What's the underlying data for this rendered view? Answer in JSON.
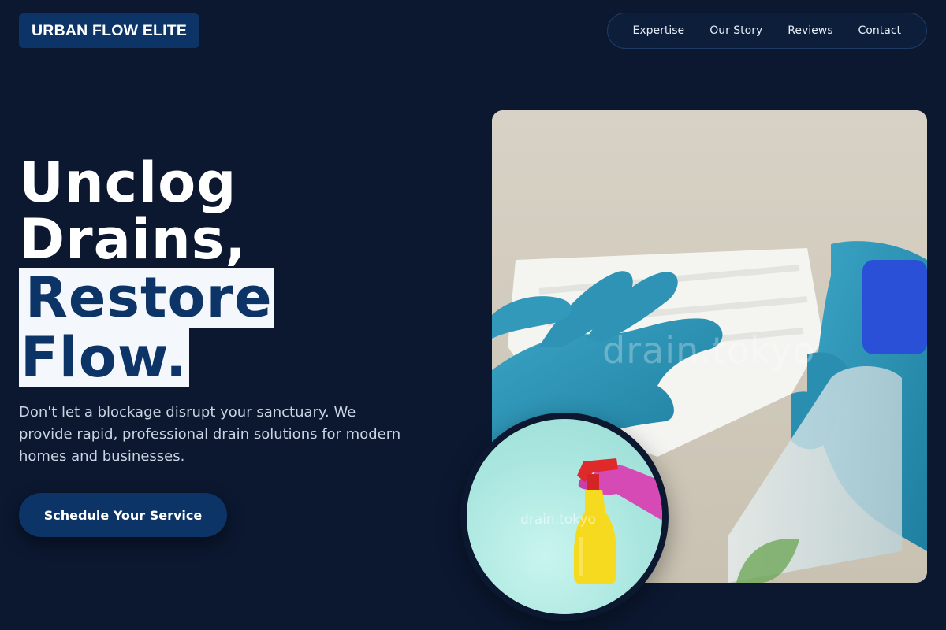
{
  "brand": {
    "name": "URBAN FLOW ELITE"
  },
  "nav": {
    "items": [
      {
        "label": "Expertise"
      },
      {
        "label": "Our Story"
      },
      {
        "label": "Reviews"
      },
      {
        "label": "Contact"
      }
    ]
  },
  "hero": {
    "headline_line1": "Unclog",
    "headline_line2": "Drains,",
    "headline_highlight1": "Restore",
    "headline_highlight2": "Flow.",
    "description": "Don't let a blockage disrupt your sanctuary. We provide rapid, professional drain solutions for modern homes and businesses.",
    "cta_label": "Schedule Your Service"
  },
  "media": {
    "main_photo_watermark": "drain.tokyo",
    "circle_photo_watermark": "drain.tokyo"
  },
  "colors": {
    "background": "#0b1830",
    "primary": "#0d3466",
    "highlight_bg": "#f4f7fb",
    "text_muted": "#c9d4e3"
  }
}
